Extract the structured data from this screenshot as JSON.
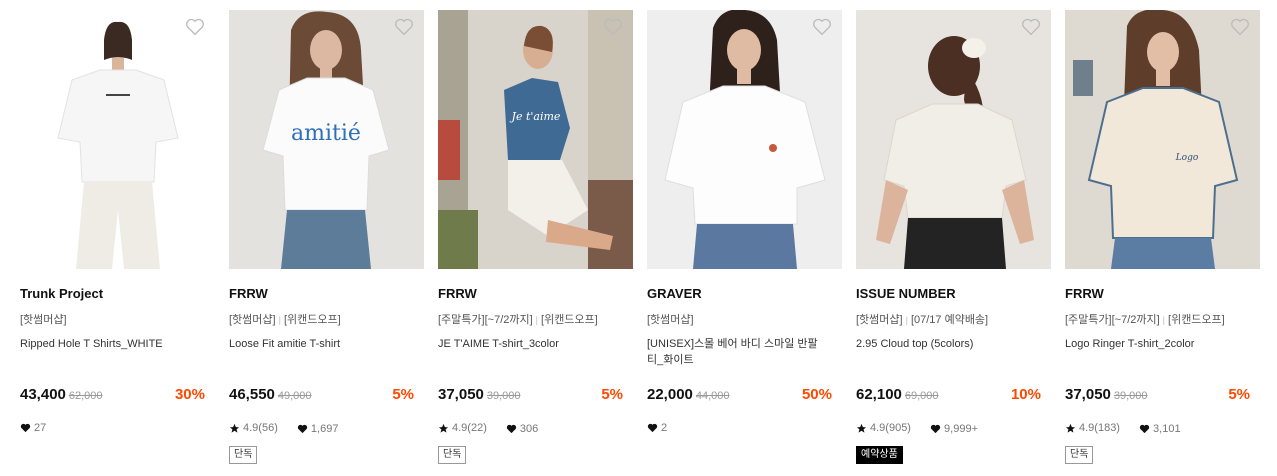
{
  "products": [
    {
      "brand": "Trunk Project",
      "tags": [
        "[핫썸머샵]"
      ],
      "name": "Ripped Hole T Shirts_WHITE",
      "price": "43,400",
      "original_price": "62,000",
      "discount": "30%",
      "rating": "",
      "likes": "27",
      "badge": ""
    },
    {
      "brand": "FRRW",
      "tags": [
        "[핫썸머샵]",
        "[위캔드오프]"
      ],
      "name": "Loose Fit amitie T-shirt",
      "price": "46,550",
      "original_price": "49,000",
      "discount": "5%",
      "rating": "4.9(56)",
      "likes": "1,697",
      "badge": "단독"
    },
    {
      "brand": "FRRW",
      "tags": [
        "[주말특가][~7/2까지]",
        "[위캔드오프]"
      ],
      "name": "JE T'AIME T-shirt_3color",
      "price": "37,050",
      "original_price": "39,000",
      "discount": "5%",
      "rating": "4.9(22)",
      "likes": "306",
      "badge": "단독"
    },
    {
      "brand": "GRAVER",
      "tags": [
        "[핫썸머샵]"
      ],
      "name": "[UNISEX]스몰 베어 바디 스마일 반팔티_화이트",
      "price": "22,000",
      "original_price": "44,000",
      "discount": "50%",
      "rating": "",
      "likes": "2",
      "badge": ""
    },
    {
      "brand": "ISSUE NUMBER",
      "tags": [
        "[핫썸머샵]",
        "[07/17 예약배송]"
      ],
      "name": "2.95 Cloud top (5colors)",
      "price": "62,100",
      "original_price": "69,000",
      "discount": "10%",
      "rating": "4.9(905)",
      "likes": "9,999+",
      "badge": "예약상품"
    },
    {
      "brand": "FRRW",
      "tags": [
        "[주말특가][~7/2까지]",
        "[위캔드오프]"
      ],
      "name": "Logo Ringer T-shirt_2color",
      "price": "37,050",
      "original_price": "39,000",
      "discount": "5%",
      "rating": "4.9(183)",
      "likes": "3,101",
      "badge": "단독"
    }
  ],
  "colors": {
    "discount": "#ff4800",
    "price": "#111111",
    "muted": "#999999"
  },
  "icons": {
    "wishlist": "heart-outline-icon",
    "rating": "star-icon",
    "likes": "heart-filled-icon"
  }
}
